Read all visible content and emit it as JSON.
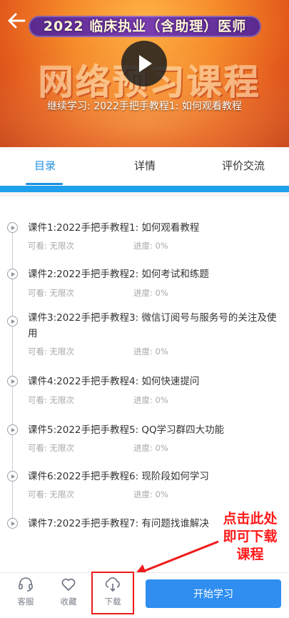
{
  "video": {
    "banner_title": "2022 临床执业（含助理）医师",
    "banner_subtitle": "网络预习课程",
    "continue_text": "继续学习: 2022手把手教程1: 如何观看教程"
  },
  "tabs": [
    {
      "label": "目录",
      "active": true
    },
    {
      "label": "详情",
      "active": false
    },
    {
      "label": "评价交流",
      "active": false
    }
  ],
  "lessons": [
    {
      "title": "课件1:2022手把手教程1: 如何观看教程",
      "viewable": "可看: 无限次",
      "progress": "进度: 0%"
    },
    {
      "title": "课件2:2022手把手教程2: 如何考试和练题",
      "viewable": "可看: 无限次",
      "progress": "进度: 0%"
    },
    {
      "title": "课件3:2022手把手教程3: 微信订阅号与服务号的关注及使用",
      "viewable": "可看: 无限次",
      "progress": "进度: 0%"
    },
    {
      "title": "课件4:2022手把手教程4: 如何快速提问",
      "viewable": "可看: 无限次",
      "progress": "进度: 0%"
    },
    {
      "title": "课件5:2022手把手教程5: QQ学习群四大功能",
      "viewable": "可看: 无限次",
      "progress": "进度: 0%"
    },
    {
      "title": "课件6:2022手把手教程6: 现阶段如何学习",
      "viewable": "可看: 无限次",
      "progress": "进度: 0%"
    },
    {
      "title": "课件7:2022手把手教程7: 有问题找谁解决",
      "viewable": "",
      "progress": ""
    }
  ],
  "annotation": {
    "lines": [
      "点击此处",
      "即可下载",
      "课程"
    ],
    "color": "#ff1a1a"
  },
  "bottom_bar": {
    "service_label": "客服",
    "favorite_label": "收藏",
    "download_label": "下载",
    "start_label": "开始学习"
  },
  "colors": {
    "accent": "#1e90e0",
    "button": "#2f8ef0",
    "annotation": "#ee1b1b"
  }
}
